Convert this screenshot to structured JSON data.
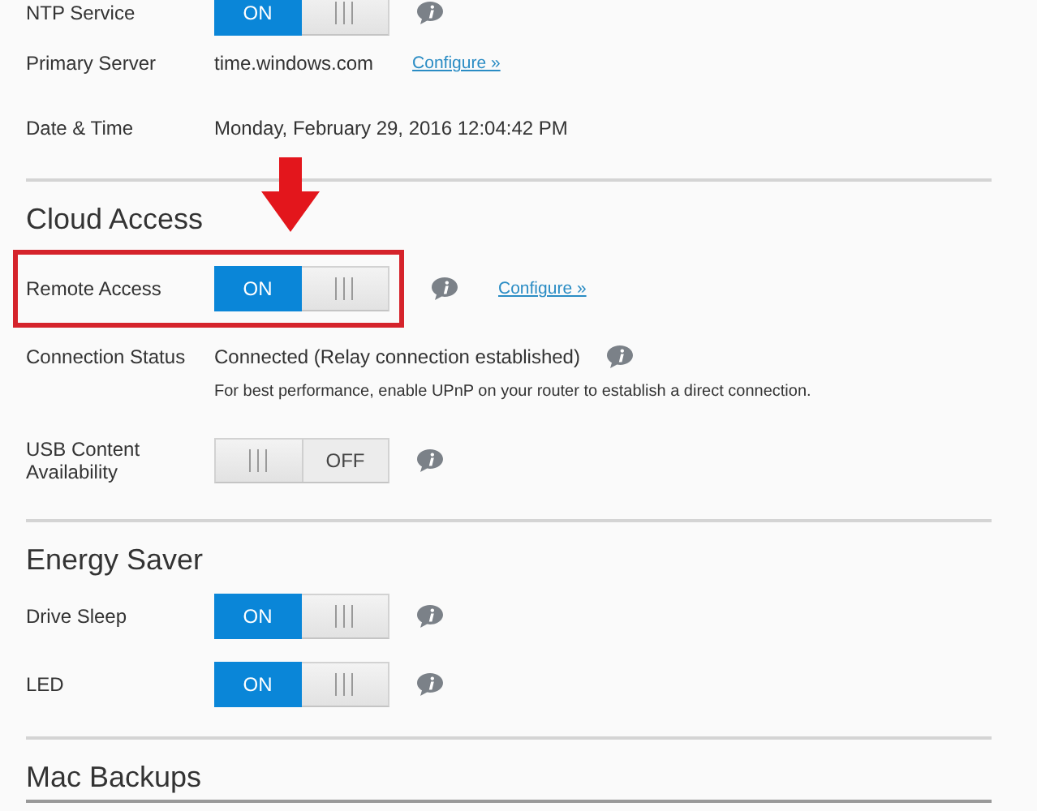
{
  "sections": [
    {
      "rows": [
        {
          "kind": "toggle",
          "label": "NTP Service",
          "toggle": {
            "on": true,
            "label": "ON"
          },
          "info": true,
          "highlighted": false
        },
        {
          "kind": "text",
          "label": "Primary Server",
          "value": "time.windows.com",
          "link": "Configure »",
          "highlighted": false
        },
        {
          "kind": "text",
          "label": "Date & Time",
          "value": "Monday, February 29, 2016 12:04:42 PM",
          "highlighted": false
        }
      ]
    },
    {
      "title": "Cloud Access",
      "pointer_arrow": true,
      "rows": [
        {
          "kind": "toggle",
          "label": "Remote Access",
          "toggle": {
            "on": true,
            "label": "ON"
          },
          "info": true,
          "link": "Configure »",
          "highlighted": true
        },
        {
          "kind": "text",
          "label": "Connection Status",
          "value": "Connected (Relay connection established)",
          "info": true,
          "note": "For best performance, enable UPnP on your router to establish a direct connection.",
          "highlighted": false
        },
        {
          "kind": "toggle",
          "label": "USB Content Availability",
          "toggle": {
            "on": false,
            "label": "OFF"
          },
          "info": true,
          "highlighted": false
        }
      ]
    },
    {
      "title": "Energy Saver",
      "rows": [
        {
          "kind": "toggle",
          "label": "Drive Sleep",
          "toggle": {
            "on": true,
            "label": "ON"
          },
          "info": true,
          "highlighted": false
        },
        {
          "kind": "toggle",
          "label": "LED",
          "toggle": {
            "on": true,
            "label": "ON"
          },
          "info": true,
          "highlighted": false
        }
      ]
    },
    {
      "title": "Mac Backups"
    }
  ]
}
